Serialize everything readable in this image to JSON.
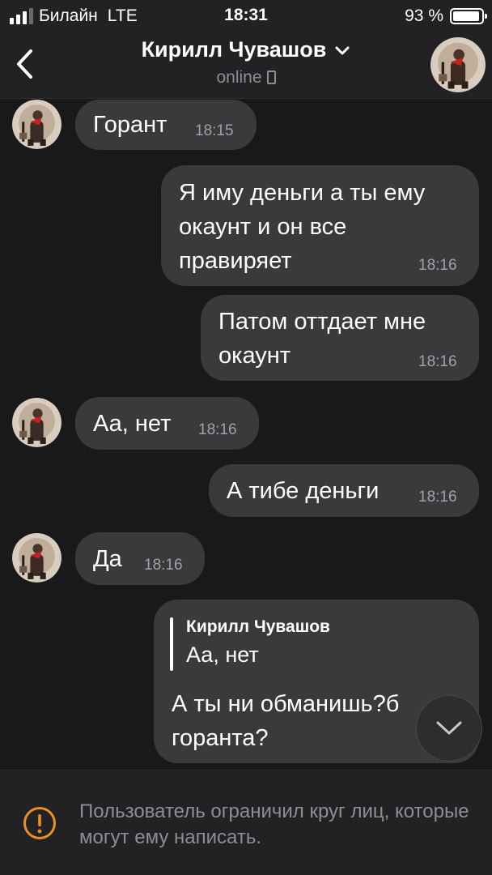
{
  "status_bar": {
    "carrier": "Билайн",
    "network": "LTE",
    "time": "18:31",
    "battery": "93 %",
    "battery_level": 0.93,
    "signal_bars": 3
  },
  "header": {
    "title": "Кирилл Чувашов",
    "subtitle": "online"
  },
  "messages": [
    {
      "direction": "incoming",
      "text": "Горант",
      "time": "18:15"
    },
    {
      "direction": "outgoing",
      "text": "Я иму деньги а ты ему окаунт и он все правиряет",
      "time": "18:16"
    },
    {
      "direction": "outgoing",
      "text": "Патом оттдает мне окаунт",
      "time": "18:16"
    },
    {
      "direction": "incoming",
      "text": "Аа, нет",
      "time": "18:16"
    },
    {
      "direction": "outgoing",
      "text": "А тибе деньги",
      "time": "18:16"
    },
    {
      "direction": "incoming",
      "text": "Да",
      "time": "18:16"
    },
    {
      "direction": "outgoing",
      "reply_to": {
        "name": "Кирилл Чувашов",
        "text": "Аа, нет"
      },
      "text": "А ты ни обманишь?б",
      "text_line2": "горанта?"
    }
  ],
  "footer": {
    "notice": "Пользователь ограничил круг лиц, которые могут ему написать."
  },
  "colors": {
    "background": "#19191b",
    "bar": "#222224",
    "bubble": "#3a3a3c",
    "secondary_text": "#8e8e93",
    "warning": "#e9921f"
  },
  "icons": {
    "back": "chevron-left-icon",
    "title_menu": "chevron-down-icon",
    "device": "phone-icon",
    "scroll": "chevron-down-icon",
    "warning": "warning-circle-icon"
  }
}
